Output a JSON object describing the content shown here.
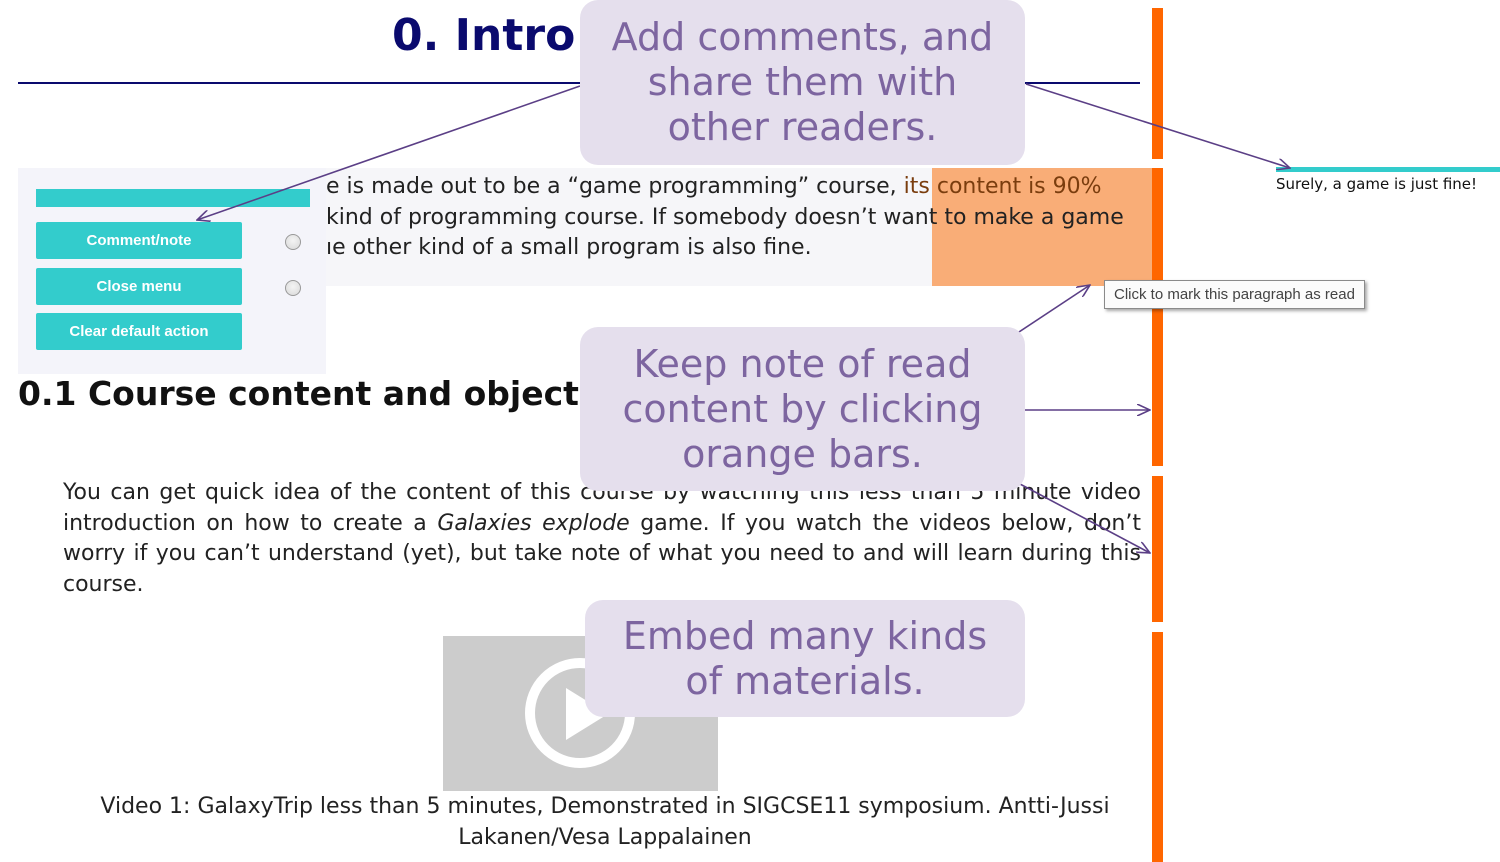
{
  "page": {
    "title": "0. Intro",
    "paragraph_lines": [
      "e is made out to be a “game programming” course, ",
      "kind of programming course. If somebody doesn’t want to make a game",
      "ıe other kind of a small program is also fine."
    ],
    "paragraph_highlight_end": "its content is 90%",
    "heading": "0.1 Course content and objecti",
    "body_lines": [
      "You can get quick idea of the content of this course by watching this less than 5 minute video",
      "introduction on how to create a ",
      "worry if you can’t understand (yet), but take note of what you need to and will learn during this",
      "course."
    ],
    "body_italic": "Galaxies explode",
    "body_line2_rest": " game. If you watch the videos below, don’t",
    "caption_lines": [
      "Video 1: GalaxyTrip less than 5 minutes, Demonstrated in SIGCSE11 symposium. Antti-Jussi",
      "Lakanen/Vesa Lappalainen"
    ]
  },
  "menu": {
    "buttons": [
      "Comment/note",
      "Close menu",
      "Clear default action"
    ]
  },
  "comment": {
    "text": "Surely, a game is just fine!"
  },
  "tooltip": {
    "text": "Click to mark this paragraph as read"
  },
  "callouts": [
    {
      "lines": [
        "Add comments, and",
        "share them with",
        "other readers."
      ]
    },
    {
      "lines": [
        "Keep note of read",
        "content by clicking",
        "orange bars."
      ]
    },
    {
      "lines": [
        "Embed many kinds",
        "of materials."
      ]
    }
  ],
  "colors": {
    "accent_teal": "#33cccc",
    "read_bar_orange": "#ff6600",
    "highlight_orange": "#f9ad77",
    "title_navy": "#0a0a6e",
    "callout_bg": "#e5dfed",
    "callout_text": "#7d65a0"
  }
}
